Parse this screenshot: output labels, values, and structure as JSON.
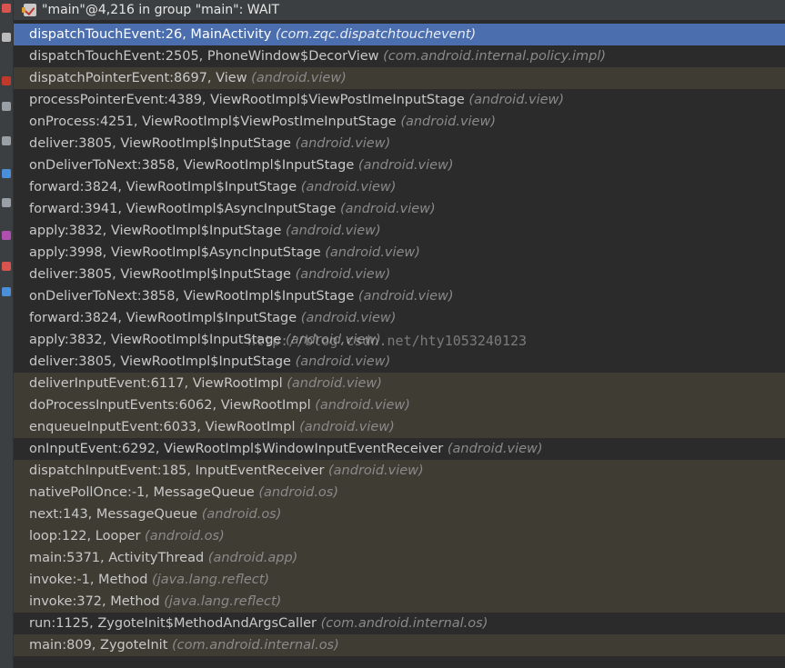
{
  "header": {
    "thread_label": "\"main\"@4,216 in group \"main\": WAIT"
  },
  "frames": [
    {
      "method": "dispatchTouchEvent:26, MainActivity",
      "package": "(com.zqc.dispatchtouchevent)",
      "kind": "selected"
    },
    {
      "method": "dispatchTouchEvent:2505, PhoneWindow$DecorView",
      "package": "(com.android.internal.policy.impl)",
      "kind": "normal"
    },
    {
      "method": "dispatchPointerEvent:8697, View",
      "package": "(android.view)",
      "kind": "library"
    },
    {
      "method": "processPointerEvent:4389, ViewRootImpl$ViewPostImeInputStage",
      "package": "(android.view)",
      "kind": "normal"
    },
    {
      "method": "onProcess:4251, ViewRootImpl$ViewPostImeInputStage",
      "package": "(android.view)",
      "kind": "normal"
    },
    {
      "method": "deliver:3805, ViewRootImpl$InputStage",
      "package": "(android.view)",
      "kind": "normal"
    },
    {
      "method": "onDeliverToNext:3858, ViewRootImpl$InputStage",
      "package": "(android.view)",
      "kind": "normal"
    },
    {
      "method": "forward:3824, ViewRootImpl$InputStage",
      "package": "(android.view)",
      "kind": "normal"
    },
    {
      "method": "forward:3941, ViewRootImpl$AsyncInputStage",
      "package": "(android.view)",
      "kind": "normal"
    },
    {
      "method": "apply:3832, ViewRootImpl$InputStage",
      "package": "(android.view)",
      "kind": "normal"
    },
    {
      "method": "apply:3998, ViewRootImpl$AsyncInputStage",
      "package": "(android.view)",
      "kind": "normal"
    },
    {
      "method": "deliver:3805, ViewRootImpl$InputStage",
      "package": "(android.view)",
      "kind": "normal"
    },
    {
      "method": "onDeliverToNext:3858, ViewRootImpl$InputStage",
      "package": "(android.view)",
      "kind": "normal"
    },
    {
      "method": "forward:3824, ViewRootImpl$InputStage",
      "package": "(android.view)",
      "kind": "normal"
    },
    {
      "method": "apply:3832, ViewRootImpl$InputStage",
      "package": "(android.view)",
      "kind": "normal"
    },
    {
      "method": "deliver:3805, ViewRootImpl$InputStage",
      "package": "(android.view)",
      "kind": "normal"
    },
    {
      "method": "deliverInputEvent:6117, ViewRootImpl",
      "package": "(android.view)",
      "kind": "library"
    },
    {
      "method": "doProcessInputEvents:6062, ViewRootImpl",
      "package": "(android.view)",
      "kind": "library"
    },
    {
      "method": "enqueueInputEvent:6033, ViewRootImpl",
      "package": "(android.view)",
      "kind": "library"
    },
    {
      "method": "onInputEvent:6292, ViewRootImpl$WindowInputEventReceiver",
      "package": "(android.view)",
      "kind": "normal"
    },
    {
      "method": "dispatchInputEvent:185, InputEventReceiver",
      "package": "(android.view)",
      "kind": "library"
    },
    {
      "method": "nativePollOnce:-1, MessageQueue",
      "package": "(android.os)",
      "kind": "library"
    },
    {
      "method": "next:143, MessageQueue",
      "package": "(android.os)",
      "kind": "library"
    },
    {
      "method": "loop:122, Looper",
      "package": "(android.os)",
      "kind": "library"
    },
    {
      "method": "main:5371, ActivityThread",
      "package": "(android.app)",
      "kind": "library"
    },
    {
      "method": "invoke:-1, Method",
      "package": "(java.lang.reflect)",
      "kind": "library"
    },
    {
      "method": "invoke:372, Method",
      "package": "(java.lang.reflect)",
      "kind": "library"
    },
    {
      "method": "run:1125, ZygoteInit$MethodAndArgsCaller",
      "package": "(com.android.internal.os)",
      "kind": "normal"
    },
    {
      "method": "main:809, ZygoteInit",
      "package": "(com.android.internal.os)",
      "kind": "library"
    }
  ],
  "watermark": "http://blog.csdn.net/hty1053240123",
  "gutter_icons": [
    {
      "name": "stop-icon",
      "color": "#d9534f"
    },
    {
      "name": "more-icon",
      "color": "#bbbbbb"
    },
    {
      "name": "breakpoint-icon",
      "color": "#c0392b"
    },
    {
      "name": "camera-icon",
      "color": "#9aa0a6"
    },
    {
      "name": "layout-icon",
      "color": "#9aa0a6"
    },
    {
      "name": "step-icon",
      "color": "#4a90d9"
    },
    {
      "name": "filter-icon",
      "color": "#9aa0a6"
    },
    {
      "name": "mute-icon",
      "color": "#b04fb0"
    },
    {
      "name": "close-icon",
      "color": "#d9534f"
    },
    {
      "name": "help-icon",
      "color": "#4a90d9"
    }
  ]
}
